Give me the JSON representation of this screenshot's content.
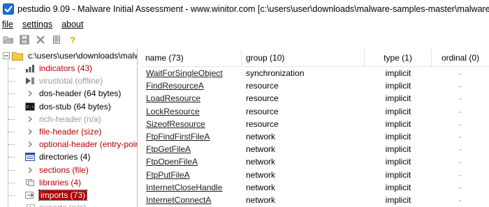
{
  "titlebar": {
    "title": "pestudio 9.09 - Malware Initial Assessment - www.winitor.com [c:\\users\\user\\downloads\\malware-samples-master\\malware-samples-"
  },
  "menu": {
    "file": "file",
    "settings": "settings",
    "about": "about"
  },
  "toolbar": {
    "icons": [
      "open-folder-icon",
      "save-icon",
      "close-icon",
      "copy-icon",
      "help-icon"
    ]
  },
  "tree": {
    "root": "c:\\users\\user\\downloads\\malw",
    "items": [
      {
        "label": "indicators (43)",
        "style": "red",
        "icon": "bar-chart-icon"
      },
      {
        "label": "virustotal (offline)",
        "style": "gray",
        "icon": "virustotal-icon"
      },
      {
        "label": "dos-header (64 bytes)",
        "style": "blk",
        "icon": "arrow-icon"
      },
      {
        "label": "dos-stub (64 bytes)",
        "style": "blk",
        "icon": "console-icon"
      },
      {
        "label": "rich-header (n/a)",
        "style": "gray",
        "icon": "arrow-icon"
      },
      {
        "label": "file-header (size)",
        "style": "red",
        "icon": "arrow-icon"
      },
      {
        "label": "optional-header (entry-poir",
        "style": "red",
        "icon": "arrow-icon"
      },
      {
        "label": "directories (4)",
        "style": "blk",
        "icon": "directory-grid-icon"
      },
      {
        "label": "sections (file)",
        "style": "red",
        "icon": "arrow-icon"
      },
      {
        "label": "libraries (4)",
        "style": "red",
        "icon": "library-icon"
      },
      {
        "label": "imports (73)",
        "style": "selected",
        "icon": "import-icon"
      },
      {
        "label": "exports (n/a)",
        "style": "gray",
        "icon": "export-icon"
      }
    ]
  },
  "table": {
    "headers": {
      "name": "name (73)",
      "group": "group (10)",
      "type": "type (1)",
      "ordinal": "ordinal (0)"
    },
    "rows": [
      {
        "name": "WaitForSingleObject",
        "group": "synchronization",
        "type": "implicit",
        "ordinal": "-"
      },
      {
        "name": "FindResourceA",
        "group": "resource",
        "type": "implicit",
        "ordinal": "-"
      },
      {
        "name": "LoadResource",
        "group": "resource",
        "type": "implicit",
        "ordinal": "-"
      },
      {
        "name": "LockResource",
        "group": "resource",
        "type": "implicit",
        "ordinal": "-"
      },
      {
        "name": "SizeofResource",
        "group": "resource",
        "type": "implicit",
        "ordinal": "-"
      },
      {
        "name": "FtpFindFirstFileA",
        "group": "network",
        "type": "implicit",
        "ordinal": "-"
      },
      {
        "name": "FtpGetFileA",
        "group": "network",
        "type": "implicit",
        "ordinal": "-"
      },
      {
        "name": "FtpOpenFileA",
        "group": "network",
        "type": "implicit",
        "ordinal": "-"
      },
      {
        "name": "FtpPutFileA",
        "group": "network",
        "type": "implicit",
        "ordinal": "-"
      },
      {
        "name": "InternetCloseHandle",
        "group": "network",
        "type": "implicit",
        "ordinal": "-"
      },
      {
        "name": "InternetConnectA",
        "group": "network",
        "type": "implicit",
        "ordinal": "-"
      }
    ]
  },
  "colors": {
    "accent_red": "#b30000",
    "disabled_gray": "#9a9a9a",
    "title_icon_blue": "#1e6fd9"
  }
}
